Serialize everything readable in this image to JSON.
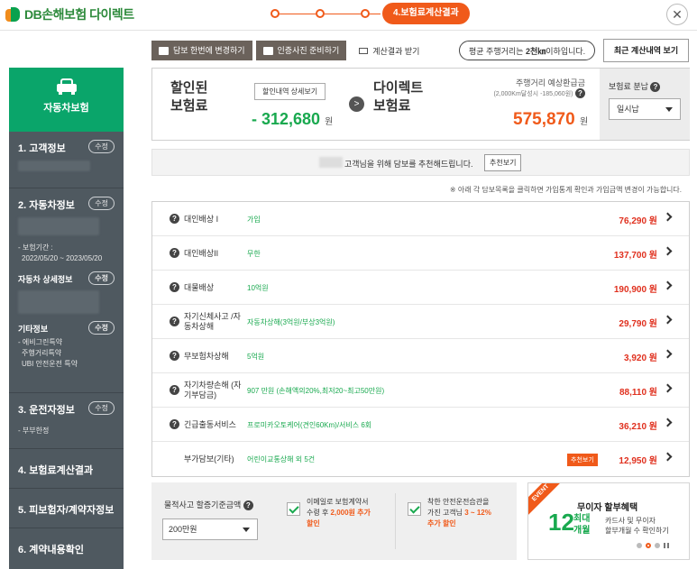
{
  "header": {
    "logo_text": "DB손해보험",
    "logo_sub": "다이렉트",
    "active_step": "4.보험료계산결과",
    "close_icon": "close-icon"
  },
  "sidebar": {
    "product": "자동차보험",
    "edit_label": "수정",
    "sections": {
      "customer": "1. 고객정보",
      "vehicle": "2. 자동차정보",
      "period_label": "- 보험기간 :",
      "period_value": "2022/05/20 ~ 2023/05/20",
      "vehicle_detail": "자동차 상세정보",
      "etc": "기타정보",
      "etc_items": [
        "- 에비그린특약",
        "주행거리특약",
        "UBI 안전운전 특약"
      ],
      "driver": "3. 운전자정보",
      "driver_value": "- 부부한정",
      "result": "4. 보험료계산결과",
      "insured": "5. 피보험자/계약자정보",
      "confirm": "6. 계약내용확인"
    }
  },
  "toolbar": {
    "change_label": "담보 한번에 변경하기",
    "photo_label": "인증사진 준비하기",
    "receive_label": "계산결과 받기",
    "tooltip_prefix": "평균 주행거리는 ",
    "tooltip_bold": "2천㎞",
    "tooltip_suffix": "이하입니다.",
    "recent_label": "최근 계산내역 보기"
  },
  "summary": {
    "discounted_title_1": "할인된",
    "discounted_title_2": "보험료",
    "detail_btn": "할인내역 상세보기",
    "discount_amount": "- 312,680",
    "won": "원",
    "direct_title_1": "다이렉트",
    "direct_title_2": "보험료",
    "refund_label": "주행거리 예상환급금",
    "refund_note": "(2,000Km달성시 -185,060원)",
    "direct_amount": "575,870",
    "pay_label": "보험료 분납",
    "pay_value": "일시납"
  },
  "recommend": {
    "text": "고객님을 위해 담보를 추천해드립니다.",
    "button": "추천보기"
  },
  "note": "※ 아래 각 담보목록을 클릭하면 가입통계 확인과 가입금액 변경이 가능합니다.",
  "coverages": [
    {
      "name": "대인배상 I",
      "value": "가입",
      "premium": "76,290 원"
    },
    {
      "name": "대인배상II",
      "value": "무한",
      "premium": "137,700 원"
    },
    {
      "name": "대물배상",
      "value": "10억원",
      "premium": "190,900 원"
    },
    {
      "name": "자기신체사고 /자동차상해",
      "value": "자동차상해(3억원/부상3억원)",
      "premium": "29,790 원"
    },
    {
      "name": "무보험차상해",
      "value": "5억원",
      "premium": "3,920 원"
    },
    {
      "name": "자기차량손해 (자기부담금)",
      "value": "907 만원 (손해액의20%,최저20~최고50만원)",
      "premium": "88,110 원"
    },
    {
      "name": "긴급출동서비스",
      "value": "프로미카오토케어(견인60Km)/서비스 6회",
      "premium": "36,210 원"
    },
    {
      "name": "부가담보(기타)",
      "value": "어린이교통상해 외 5건",
      "premium": "12,950 원",
      "tag": "추천보기"
    }
  ],
  "bottom": {
    "property_label": "물적사고 할증기준금액",
    "property_value": "200만원",
    "email_text_1": "이메일로 보험계약서",
    "email_text_2": "수령 후 ",
    "email_highlight": "2,000원 추가",
    "email_text_3": "할인",
    "safe_text_1": "착한 안전운전습관을",
    "safe_text_2": "가진 고객님 ",
    "safe_highlight": "3 ~ 12%",
    "safe_text_3": "추가 할인"
  },
  "event": {
    "ribbon": "EVENT",
    "title": "무이자 할부혜택",
    "big": "12",
    "unit_1": "최대",
    "unit_2": "개월",
    "desc_1": "카드사 및 무이자",
    "desc_2": "할부개월 수 확인하기"
  },
  "colors": {
    "accent_orange": "#f05a1a",
    "green": "#19a94f",
    "sidebar": "#4f5960",
    "premium_red": "#e0301e"
  }
}
